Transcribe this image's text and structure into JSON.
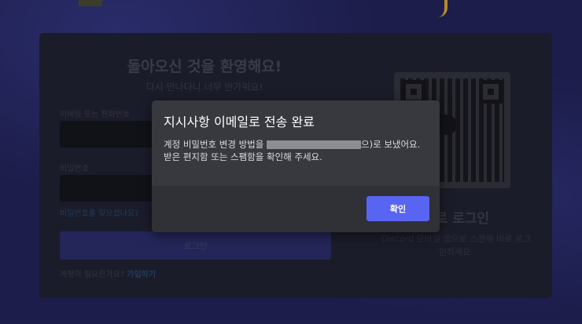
{
  "login_card": {
    "title": "돌아오신 것을 환영해요!",
    "subtitle": "다시 만나다니 너무 반가워요!",
    "email_label": "이메일 또는 전화번호",
    "password_label": "비밀번호",
    "forgot_password": "비밀번호를 잊으셨나요?",
    "login_button": "로그인",
    "register_prompt": "계정이 필요한가요?",
    "register_link": "가입하기",
    "qr_title": "드로 로그인",
    "qr_description": "Discord 모바일 앱으로 스캔해 바로 로그인하세요."
  },
  "modal": {
    "title": "지시사항 이메일로 전송 완료",
    "body_prefix": "계정 비밀번호 변경 방법을",
    "body_suffix": "으)로 보냈어요. 받은 편지함 또는 스팸함을 확인해 주세요.",
    "confirm_button": "확인"
  },
  "colors": {
    "accent": "#5865f2",
    "modal_bg": "#37393f",
    "modal_footer_bg": "#2f3136"
  }
}
